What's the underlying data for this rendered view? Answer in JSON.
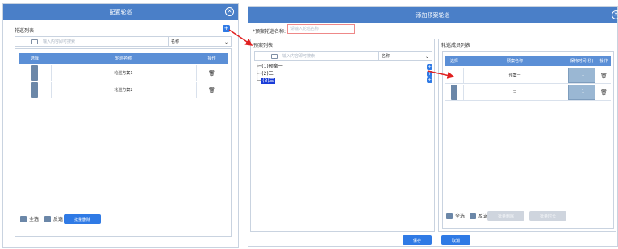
{
  "left_dialog": {
    "title": "配置轮巡",
    "list_label": "轮巡列表",
    "search_placeholder": "输入内容即可搜索",
    "search_field": "名称",
    "table_headers": [
      "选择",
      "轮巡名称",
      "操作"
    ],
    "rows": [
      {
        "name": "轮巡方案1"
      },
      {
        "name": "轮巡方案2"
      }
    ],
    "select_all": "全选",
    "invert": "反选",
    "batch_delete": "批量删除"
  },
  "right_dialog": {
    "title": "添加预案轮巡",
    "name_label": "*预案轮巡名称:",
    "name_placeholder": "请输入轮巡名称",
    "plan_list_label": "预案列表",
    "member_list_label": "轮巡成员列表",
    "search_placeholder": "输入内容即可搜索",
    "search_field": "名称",
    "tree": [
      "(1)预案一",
      "(2)二",
      "(3)三"
    ],
    "member_headers": [
      "选择",
      "预案名称",
      "保持时间(秒)",
      "操作"
    ],
    "members": [
      {
        "name": "预案一",
        "time": "1"
      },
      {
        "name": "三",
        "time": "1"
      }
    ],
    "select_all": "全选",
    "invert": "反选",
    "batch_delete": "批量删除",
    "batch_time": "批量时长",
    "save": "保存",
    "cancel": "取消"
  },
  "colors": {
    "titlebar": "#4a7fc8",
    "accent": "#2f7ae5",
    "arrow": "#e02020"
  }
}
